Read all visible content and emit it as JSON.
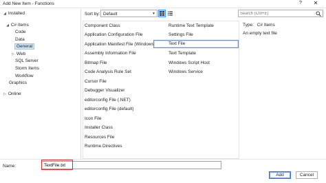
{
  "window": {
    "title": "Add New Item - Functions",
    "help_glyph": "?",
    "close_glyph": "✕"
  },
  "tree": {
    "installed": "Installed",
    "csharp_items": "C# Items",
    "children": [
      "Code",
      "Data",
      "General",
      "Web",
      "SQL Server",
      "Storm Items",
      "Workflow"
    ],
    "graphics": "Graphics",
    "online": "Online"
  },
  "toolbar": {
    "sort_by_label": "Sort by:",
    "sort_value": "Default"
  },
  "search": {
    "placeholder": "Search (Ctrl+E)"
  },
  "templates": {
    "column1": [
      "Component Class",
      "Application Configuration File",
      "Application Manifest File (Windows...",
      "Assembly Information File",
      "Bitmap File",
      "Code Analysis Rule Set",
      "Cursor File",
      "Debugger Visualizer",
      "editorconfig File (.NET)",
      "editorconfig File (default)",
      "Icon File",
      "Installer Class",
      "Resources File",
      "Runtime Directives"
    ],
    "column2": [
      "Runtime Text Template",
      "Settings File",
      "Text File",
      "Text Template",
      "Windows Script Host",
      "Windows Service"
    ]
  },
  "details": {
    "type_label": "Type:",
    "type_value": "C# Items",
    "description": "An empty text file"
  },
  "footer": {
    "name_label": "Name:",
    "name_value": "TextFile.txt",
    "add_label": "Add",
    "cancel_label": "Cancel"
  },
  "colors": {
    "selection": "#cce4f7",
    "annotation_box": "#d63031",
    "icon_blue": "#2b6cc4"
  }
}
